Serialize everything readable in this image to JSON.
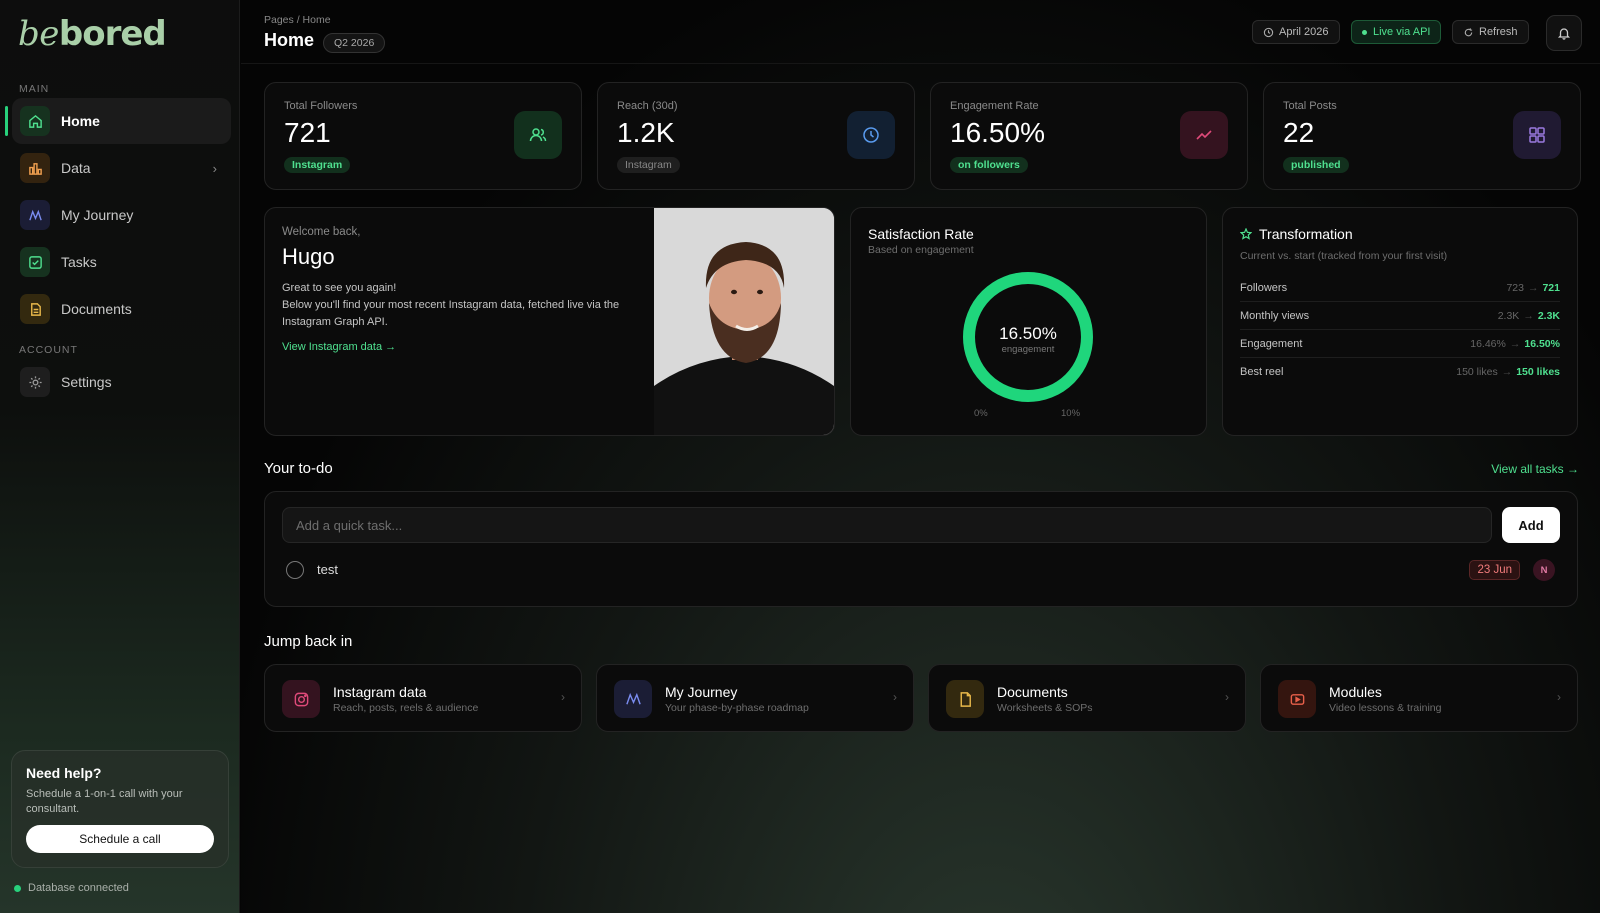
{
  "brand": {
    "logo_be": "be",
    "logo_bored": "bored",
    "accent_color": "#28d17c"
  },
  "sidebar": {
    "sections": {
      "main": "MAIN",
      "account": "ACCOUNT"
    },
    "items": [
      {
        "label": "Home",
        "icon": "home-icon"
      },
      {
        "label": "Data",
        "icon": "bar-chart-icon"
      },
      {
        "label": "My Journey",
        "icon": "journey-icon"
      },
      {
        "label": "Tasks",
        "icon": "checkbox-icon"
      },
      {
        "label": "Documents",
        "icon": "document-icon"
      },
      {
        "label": "Settings",
        "icon": "gear-icon"
      }
    ],
    "help": {
      "title": "Need help?",
      "text": "Schedule a 1-on-1 call with your consultant.",
      "button": "Schedule a call"
    },
    "db_status": "Database connected"
  },
  "header": {
    "breadcrumb": "Pages / Home",
    "title": "Home",
    "quarter": "Q2 2026",
    "month": "April 2026",
    "live": "Live via API",
    "refresh": "Refresh"
  },
  "stats": [
    {
      "label": "Total Followers",
      "value": "721",
      "pill": "Instagram",
      "icon": "users-icon",
      "color": "#4fe08f"
    },
    {
      "label": "Reach (30d)",
      "value": "1.2K",
      "pill": "Instagram",
      "icon": "clock-icon",
      "color": "#5a9cf0"
    },
    {
      "label": "Engagement Rate",
      "value": "16.50%",
      "pill": "on followers",
      "icon": "trend-icon",
      "color": "#e04a7a"
    },
    {
      "label": "Total Posts",
      "value": "22",
      "pill": "published",
      "icon": "grid-icon",
      "color": "#9a7ae0"
    }
  ],
  "welcome": {
    "small": "Welcome back,",
    "name": "Hugo",
    "line1": "Great to see you again!",
    "line2": "Below you'll find your most recent Instagram data, fetched live via the Instagram Graph API.",
    "link": "View Instagram data →"
  },
  "satisfaction": {
    "title": "Satisfaction Rate",
    "subtitle": "Based on engagement",
    "value": "16.50%",
    "caption": "engagement",
    "fraction": 1.0,
    "tick_min": "0%",
    "tick_max": "10%"
  },
  "transformation": {
    "title": "Transformation",
    "subtitle": "Current vs. start (tracked from your first visit)",
    "rows": [
      {
        "label": "Followers",
        "start": "723",
        "current": "721"
      },
      {
        "label": "Monthly views",
        "start": "2.3K",
        "current": "2.3K"
      },
      {
        "label": "Engagement",
        "start": "16.46%",
        "current": "16.50%"
      },
      {
        "label": "Best reel",
        "start": "150 likes",
        "current": "150 likes"
      }
    ]
  },
  "todo": {
    "title": "Your to-do",
    "view_all": "View all tasks →",
    "placeholder": "Add a quick task...",
    "add_label": "Add",
    "items": [
      {
        "text": "test",
        "date": "23 Jun",
        "assignee": "N"
      }
    ]
  },
  "jump": {
    "title": "Jump back in",
    "cards": [
      {
        "title": "Instagram data",
        "sub": "Reach, posts, reels & audience",
        "icon": "instagram-icon"
      },
      {
        "title": "My Journey",
        "sub": "Your phase-by-phase roadmap",
        "icon": "journey-icon"
      },
      {
        "title": "Documents",
        "sub": "Worksheets & SOPs",
        "icon": "document-icon"
      },
      {
        "title": "Modules",
        "sub": "Video lessons & training",
        "icon": "video-icon"
      }
    ]
  }
}
